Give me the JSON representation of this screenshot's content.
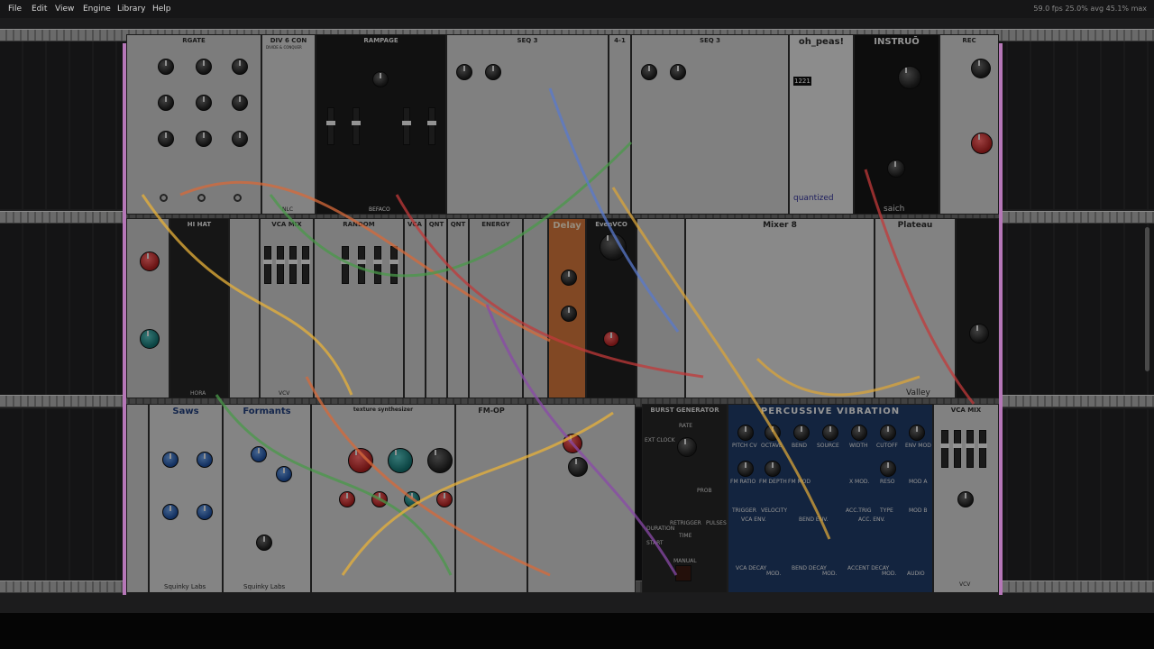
{
  "menu": [
    "File",
    "Edit",
    "View",
    "Engine",
    "Library",
    "Help"
  ],
  "perf": {
    "fps": "59.0 fps",
    "avg": "25.0% avg",
    "max": "45.1% max"
  },
  "colors": {
    "edge": "#b677b8",
    "rail": "#6a6a6a"
  },
  "modules": {
    "rgate": "RGATE",
    "div_con": "DIV 6 CON",
    "div_con_sub": "DIVIDE & CONQUER",
    "nlc": "NLC",
    "rampage": "RAMPAGE",
    "befaco": "BEFACO",
    "seq3a": "SEQ 3",
    "seq3b": "SEQ 3",
    "one_of": "4-1",
    "oh_peas": "oh_peas!",
    "oh_peas_sub": "quantized",
    "instruo": "INSTRUŌ",
    "instruo_sub": "saich",
    "rec": "REC",
    "hihat": "HI HAT",
    "hora": "HORA",
    "vca_mix": "VCA MIX",
    "random": "RANDOM",
    "vca": "VCA",
    "qnt_a": "QNT",
    "qnt_b": "QNT",
    "energy": "ENERGY",
    "delay": "Delay",
    "even_vco": "EvenVCO",
    "mixer8": "Mixer 8",
    "plateau": "Plateau",
    "valley": "Valley",
    "saws": "Saws",
    "formants": "Formants",
    "sqlatey": "Squinky Labs",
    "texture": "texture synthesizer",
    "fm_op": "FM-OP",
    "burst": "BURST GENERATOR",
    "perc_vib": "PERCUSSIVE VIBRATION",
    "vca_mix2": "VCA MIX",
    "vcv": "VCV"
  },
  "perc_labels": [
    "PITCH CV",
    "OCTAVE",
    "BEND",
    "SOURCE",
    "WIDTH",
    "CUTOFF",
    "ENV MOD",
    "FM RATIO",
    "FM DEPTH",
    "FM MOD",
    "X MOD.",
    "RESO",
    "MOD A",
    "TRIGGER",
    "VELOCITY",
    "ACC.TRIG",
    "TYPE",
    "MOD B",
    "VCA ENV.",
    "BEND ENV.",
    "ACC. ENV.",
    "VCA DECAY",
    "MOD.",
    "BEND DECAY",
    "MOD.",
    "ACCENT DECAY",
    "MOD.",
    "AUDIO"
  ],
  "plateau_readout": "1221",
  "oh_peas_label": "quantize",
  "burst_labels": [
    "RATE",
    "EXT CLOCK",
    "TIME",
    "DURATION",
    "START",
    "RETRIGGER",
    "PROB",
    "PULSES",
    "MANUAL"
  ]
}
